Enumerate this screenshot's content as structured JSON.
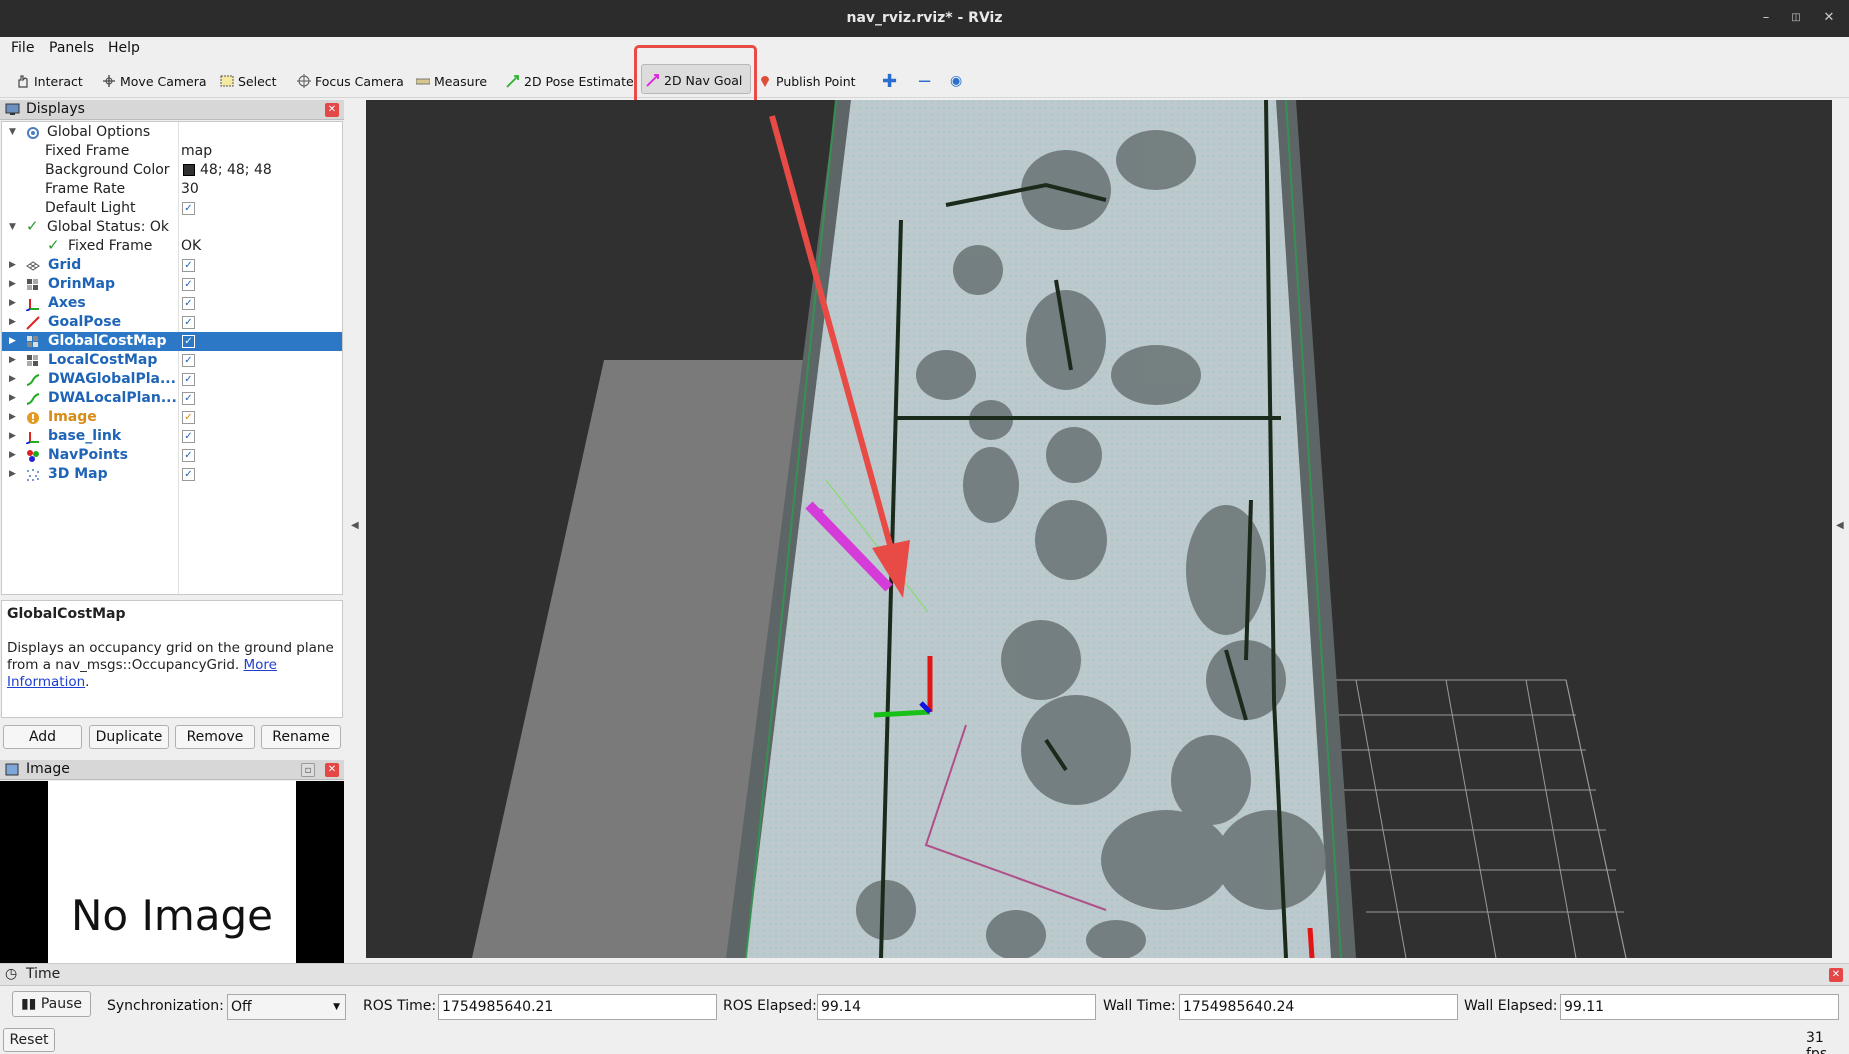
{
  "window": {
    "title": "nav_rviz.rviz* - RViz"
  },
  "menu": [
    "File",
    "Panels",
    "Help"
  ],
  "toolbar": {
    "interact": "Interact",
    "move_camera": "Move Camera",
    "select": "Select",
    "focus_camera": "Focus Camera",
    "measure": "Measure",
    "pose_estimate": "2D Pose Estimate",
    "nav_goal": "2D Nav Goal",
    "publish_point": "Publish Point"
  },
  "displays": {
    "title": "Displays",
    "global_options": "Global Options",
    "fixed_frame_label": "Fixed Frame",
    "fixed_frame_value": "map",
    "bg_color_label": "Background Color",
    "bg_color_value": "48; 48; 48",
    "bg_color": "#303030",
    "frame_rate_label": "Frame Rate",
    "frame_rate_value": "30",
    "default_light_label": "Default Light",
    "global_status": "Global Status: Ok",
    "status_fixed_frame_label": "Fixed Frame",
    "status_fixed_frame_value": "OK",
    "items": [
      "Grid",
      "OrinMap",
      "Axes",
      "GoalPose",
      "GlobalCostMap",
      "LocalCostMap",
      "DWAGlobalPla...",
      "DWALocalPlan...",
      "Image",
      "base_link",
      "NavPoints",
      "3D Map"
    ],
    "selected": "GlobalCostMap"
  },
  "description": {
    "title": "GlobalCostMap",
    "text": "Displays an occupancy grid on the ground plane from a nav_msgs::OccupancyGrid.",
    "link1": "More",
    "link2": "Information",
    "tail": "."
  },
  "buttons": {
    "add": "Add",
    "duplicate": "Duplicate",
    "remove": "Remove",
    "rename": "Rename"
  },
  "image_panel": {
    "title": "Image",
    "no_image": "No Image"
  },
  "time": {
    "title": "Time",
    "pause": "Pause",
    "sync_label": "Synchronization:",
    "sync_value": "Off",
    "ros_time_label": "ROS Time:",
    "ros_time": "1754985640.21",
    "ros_elapsed_label": "ROS Elapsed:",
    "ros_elapsed": "99.14",
    "wall_time_label": "Wall Time:",
    "wall_time": "1754985640.24",
    "wall_elapsed_label": "Wall Elapsed:",
    "wall_elapsed": "99.11",
    "reset": "Reset",
    "fps": "31 fps"
  },
  "colors": {
    "highlight": "#e84a45",
    "selection": "#2d78c6",
    "link": "#1f64b6"
  }
}
